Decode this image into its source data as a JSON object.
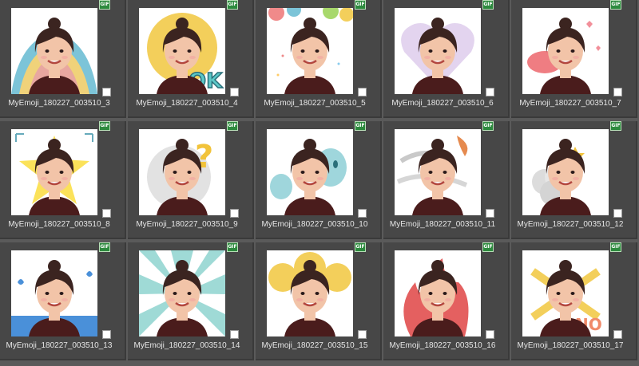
{
  "badge_text": "GIF",
  "files": [
    {
      "name": "MyEmoji_180227_003510_3",
      "sticker": "rainbow"
    },
    {
      "name": "MyEmoji_180227_003510_4",
      "sticker": "ok"
    },
    {
      "name": "MyEmoji_180227_003510_5",
      "sticker": "balloons"
    },
    {
      "name": "MyEmoji_180227_003510_6",
      "sticker": "heart"
    },
    {
      "name": "MyEmoji_180227_003510_7",
      "sticker": "kiss"
    },
    {
      "name": "MyEmoji_180227_003510_8",
      "sticker": "star"
    },
    {
      "name": "MyEmoji_180227_003510_9",
      "sticker": "question"
    },
    {
      "name": "MyEmoji_180227_003510_10",
      "sticker": "ghosts"
    },
    {
      "name": "MyEmoji_180227_003510_11",
      "sticker": "wind"
    },
    {
      "name": "MyEmoji_180227_003510_12",
      "sticker": "cloud"
    },
    {
      "name": "MyEmoji_180227_003510_13",
      "sticker": "crying"
    },
    {
      "name": "MyEmoji_180227_003510_14",
      "sticker": "rays"
    },
    {
      "name": "MyEmoji_180227_003510_15",
      "sticker": "cheeks"
    },
    {
      "name": "MyEmoji_180227_003510_16",
      "sticker": "fire"
    },
    {
      "name": "MyEmoji_180227_003510_17",
      "sticker": "no"
    }
  ],
  "colors": {
    "background": "#5a5a5a",
    "cell": "#474747",
    "label_text": "#e6e6e6",
    "gif_badge": "#2d8a3e",
    "hair": "#3b2420",
    "skin": "#f2c4a8",
    "shirt": "#4a1c1c"
  }
}
